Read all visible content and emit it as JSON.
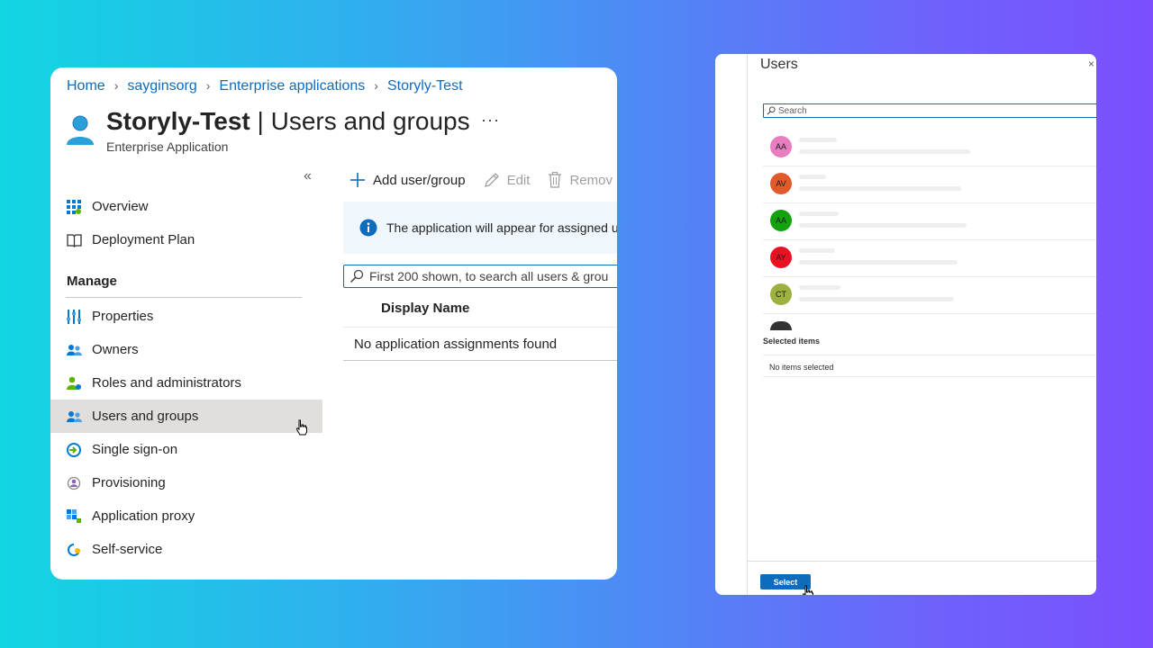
{
  "breadcrumb": [
    "Home",
    "sayginsorg",
    "Enterprise applications",
    "Storyly-Test"
  ],
  "header": {
    "title": "Storyly-Test",
    "separator": "|",
    "section": "Users and groups",
    "more": "···",
    "subtitle": "Enterprise Application",
    "collapse": "«"
  },
  "nav": {
    "top_items": [
      "Overview",
      "Deployment Plan"
    ],
    "manage_heading": "Manage",
    "manage_items": [
      "Properties",
      "Owners",
      "Roles and administrators",
      "Users and groups",
      "Single sign-on",
      "Provisioning",
      "Application proxy",
      "Self-service"
    ],
    "active": "Users and groups"
  },
  "toolbar": {
    "add": "Add user/group",
    "edit": "Edit",
    "remove": "Remov"
  },
  "info": {
    "text": "The application will appear for assigned us"
  },
  "search": {
    "placeholder": "First 200 shown, to search all users & grou"
  },
  "table": {
    "column": "Display Name",
    "empty": "No application assignments found"
  },
  "panel": {
    "title": "Users",
    "close": "×",
    "search_placeholder": "Search",
    "users": [
      {
        "initials": "AA",
        "color": "#e87dc0"
      },
      {
        "initials": "AV",
        "color": "#e05a2b"
      },
      {
        "initials": "AA",
        "color": "#13a10e"
      },
      {
        "initials": "AY",
        "color": "#e81123"
      },
      {
        "initials": "CT",
        "color": "#9bb23f"
      }
    ],
    "selected_heading": "Selected items",
    "no_items": "No items selected",
    "select_button": "Select"
  },
  "colors": {
    "accent": "#0f6cbd",
    "active_nav": "#e1dfdd"
  }
}
